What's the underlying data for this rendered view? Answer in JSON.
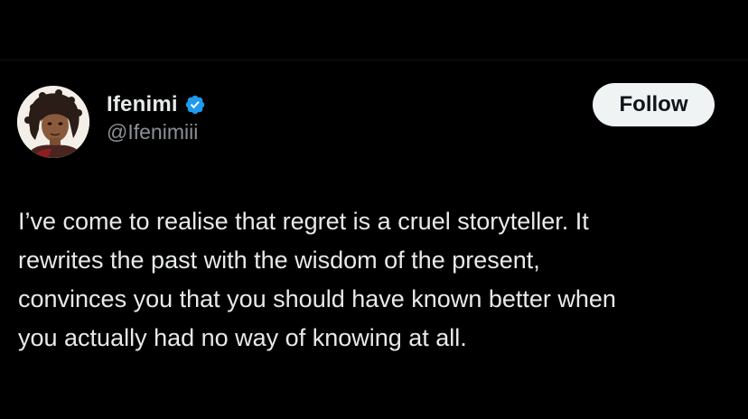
{
  "author": {
    "display_name": "Ifenimi",
    "handle": "@Ifenimiii",
    "verified": true,
    "avatar": "illustrated-portrait-avatar"
  },
  "follow_button": {
    "label": "Follow"
  },
  "tweet": {
    "lines": [
      "I’ve come to realise that regret is a cruel storyteller. It",
      "rewrites the past with the wisdom of the present,",
      "convinces you that you should have known better when",
      "you actually had no way of knowing at all."
    ]
  },
  "colors": {
    "background": "#000000",
    "text_primary": "#e7e9ea",
    "text_secondary": "#8b9096",
    "verified_badge": "#1d9bf0",
    "follow_button_bg": "#eff3f4",
    "follow_button_text": "#0f1419"
  }
}
